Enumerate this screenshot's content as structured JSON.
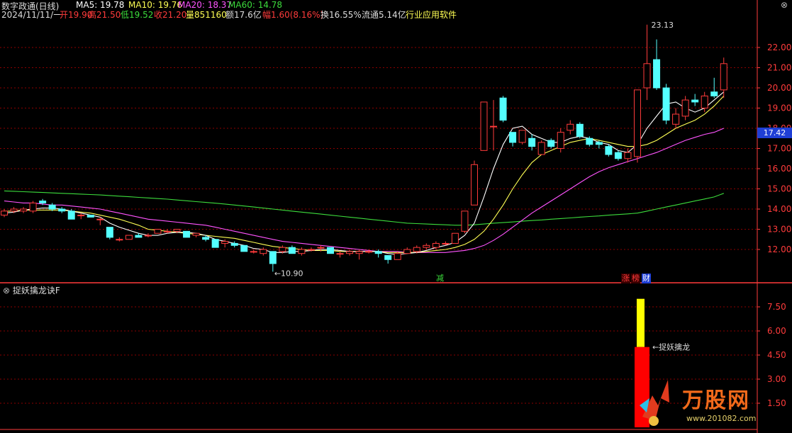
{
  "header": {
    "title": "数字政通(日线)",
    "ma5": "MA5: 19.78",
    "ma10": "MA10: 19.76",
    "ma20": "MA20: 18.37",
    "ma60": "MA60: 14.78",
    "date": "2024/11/11/一",
    "open": "开19.90",
    "high": "高21.50",
    "low": "低19.52",
    "close": "收21.20",
    "volume": "量851160",
    "amount": "额17.6亿",
    "change": "幅1.60(8.16%)",
    "turnover": "换16.55%",
    "float": "流通5.14亿",
    "industry": "行业应用软件"
  },
  "colors": {
    "up": "#ff3b3b",
    "down": "#54ffff",
    "ma5": "#ffffff",
    "ma10": "#ffff54",
    "ma20": "#ff54ff",
    "ma60": "#3cdc3c",
    "grid": "#8b0000",
    "axis": "#ff3b3b",
    "price_tag": "#1f3fd6",
    "signal_yellow": "#ffff00",
    "signal_red": "#ff0000"
  },
  "price_axis": {
    "ticks": [
      "22.00",
      "21.00",
      "20.00",
      "19.00",
      "18.00",
      "17.00",
      "16.00",
      "15.00",
      "14.00",
      "13.00",
      "12.00"
    ],
    "current_price": "17.42"
  },
  "annotations": {
    "high_label": "23.13",
    "low_label": "←10.90"
  },
  "tags": {
    "jian": "减",
    "zhang": "涨",
    "bang": "榜",
    "cai": "财"
  },
  "indicator": {
    "title": "捉妖擒龙诀F",
    "signal_label": "←捉妖擒龙",
    "ticks": [
      "7.50",
      "6.00",
      "4.50",
      "3.00",
      "1.50"
    ],
    "bar_yellow_top": 8.0,
    "bar_red_top": 5.0
  },
  "watermark": {
    "text": "万股网",
    "url": "www.201082.com"
  },
  "chart_data": {
    "type": "candlestick",
    "candles": [
      {
        "o": 13.7,
        "c": 13.9,
        "h": 14.0,
        "l": 13.6
      },
      {
        "o": 13.9,
        "c": 14.0,
        "h": 14.1,
        "l": 13.8
      },
      {
        "o": 13.9,
        "c": 14.0,
        "h": 14.1,
        "l": 13.8
      },
      {
        "o": 13.9,
        "c": 14.3,
        "h": 14.4,
        "l": 13.8
      },
      {
        "o": 14.4,
        "c": 14.3,
        "h": 14.5,
        "l": 14.2
      },
      {
        "o": 14.2,
        "c": 14.0,
        "h": 14.3,
        "l": 13.9
      },
      {
        "o": 14.0,
        "c": 13.9,
        "h": 14.1,
        "l": 13.8
      },
      {
        "o": 13.9,
        "c": 13.5,
        "h": 14.0,
        "l": 13.5
      },
      {
        "o": 13.7,
        "c": 13.7,
        "h": 13.8,
        "l": 13.5
      },
      {
        "o": 13.7,
        "c": 13.6,
        "h": 13.7,
        "l": 13.6
      },
      {
        "o": 13.5,
        "c": 13.5,
        "h": 13.6,
        "l": 13.2
      },
      {
        "o": 13.1,
        "c": 12.6,
        "h": 13.1,
        "l": 12.5
      },
      {
        "o": 12.5,
        "c": 12.5,
        "h": 12.6,
        "l": 12.4
      },
      {
        "o": 12.5,
        "c": 12.7,
        "h": 12.7,
        "l": 12.5
      },
      {
        "o": 12.7,
        "c": 12.6,
        "h": 12.8,
        "l": 12.6
      },
      {
        "o": 12.7,
        "c": 12.7,
        "h": 12.8,
        "l": 12.6
      },
      {
        "o": 12.8,
        "c": 13.0,
        "h": 13.0,
        "l": 12.8
      },
      {
        "o": 12.9,
        "c": 12.9,
        "h": 13.0,
        "l": 12.8
      },
      {
        "o": 12.9,
        "c": 13.0,
        "h": 13.0,
        "l": 12.8
      },
      {
        "o": 12.9,
        "c": 12.6,
        "h": 12.9,
        "l": 12.6
      },
      {
        "o": 12.7,
        "c": 12.8,
        "h": 12.8,
        "l": 12.6
      },
      {
        "o": 12.6,
        "c": 12.5,
        "h": 12.7,
        "l": 12.4
      },
      {
        "o": 12.5,
        "c": 12.1,
        "h": 12.5,
        "l": 12.1
      },
      {
        "o": 12.3,
        "c": 12.4,
        "h": 12.5,
        "l": 12.1
      },
      {
        "o": 12.3,
        "c": 12.2,
        "h": 12.4,
        "l": 12.1
      },
      {
        "o": 12.2,
        "c": 11.9,
        "h": 12.2,
        "l": 11.9
      },
      {
        "o": 11.9,
        "c": 11.9,
        "h": 12.0,
        "l": 11.8
      },
      {
        "o": 11.8,
        "c": 12.0,
        "h": 12.1,
        "l": 11.7
      },
      {
        "o": 11.9,
        "c": 11.3,
        "h": 11.9,
        "l": 10.9
      },
      {
        "o": 11.9,
        "c": 12.1,
        "h": 12.2,
        "l": 11.8
      },
      {
        "o": 12.1,
        "c": 11.8,
        "h": 12.2,
        "l": 11.8
      },
      {
        "o": 11.8,
        "c": 12.0,
        "h": 12.1,
        "l": 11.7
      },
      {
        "o": 12.0,
        "c": 12.0,
        "h": 12.1,
        "l": 11.9
      },
      {
        "o": 12.1,
        "c": 12.1,
        "h": 12.2,
        "l": 11.9
      },
      {
        "o": 12.1,
        "c": 11.8,
        "h": 12.1,
        "l": 11.8
      },
      {
        "o": 11.8,
        "c": 11.8,
        "h": 11.9,
        "l": 11.6
      },
      {
        "o": 11.8,
        "c": 11.9,
        "h": 12.0,
        "l": 11.7
      },
      {
        "o": 11.8,
        "c": 11.9,
        "h": 12.0,
        "l": 11.5
      },
      {
        "o": 11.9,
        "c": 11.9,
        "h": 12.0,
        "l": 11.8
      },
      {
        "o": 11.9,
        "c": 11.8,
        "h": 12.0,
        "l": 11.6
      },
      {
        "o": 11.7,
        "c": 11.5,
        "h": 11.7,
        "l": 11.3
      },
      {
        "o": 11.5,
        "c": 11.8,
        "h": 11.9,
        "l": 11.5
      },
      {
        "o": 11.8,
        "c": 12.0,
        "h": 12.1,
        "l": 11.8
      },
      {
        "o": 11.9,
        "c": 12.1,
        "h": 12.2,
        "l": 11.8
      },
      {
        "o": 12.1,
        "c": 12.2,
        "h": 12.3,
        "l": 12.0
      },
      {
        "o": 12.1,
        "c": 12.3,
        "h": 12.4,
        "l": 12.0
      },
      {
        "o": 12.3,
        "c": 12.3,
        "h": 12.4,
        "l": 12.2
      },
      {
        "o": 12.3,
        "c": 12.8,
        "h": 12.8,
        "l": 12.3
      },
      {
        "o": 12.9,
        "c": 13.9,
        "h": 13.9,
        "l": 12.8
      },
      {
        "o": 14.2,
        "c": 16.2,
        "h": 16.4,
        "l": 14.2
      },
      {
        "o": 16.9,
        "c": 19.3,
        "h": 19.3,
        "l": 16.9
      },
      {
        "o": 18.1,
        "c": 18.1,
        "h": 19.4,
        "l": 16.9
      },
      {
        "o": 19.5,
        "c": 18.4,
        "h": 19.6,
        "l": 18.3
      },
      {
        "o": 17.8,
        "c": 17.3,
        "h": 17.8,
        "l": 17.1
      },
      {
        "o": 17.3,
        "c": 17.9,
        "h": 17.9,
        "l": 17.2
      },
      {
        "o": 17.5,
        "c": 17.1,
        "h": 17.7,
        "l": 16.9
      },
      {
        "o": 16.7,
        "c": 17.3,
        "h": 17.4,
        "l": 16.7
      },
      {
        "o": 17.4,
        "c": 17.1,
        "h": 17.5,
        "l": 17.0
      },
      {
        "o": 17.0,
        "c": 17.8,
        "h": 18.0,
        "l": 16.8
      },
      {
        "o": 17.9,
        "c": 18.2,
        "h": 18.4,
        "l": 17.7
      },
      {
        "o": 18.2,
        "c": 17.6,
        "h": 18.3,
        "l": 17.5
      },
      {
        "o": 17.5,
        "c": 17.2,
        "h": 17.6,
        "l": 17.1
      },
      {
        "o": 17.3,
        "c": 17.2,
        "h": 17.4,
        "l": 17.0
      },
      {
        "o": 17.1,
        "c": 16.7,
        "h": 17.2,
        "l": 16.6
      },
      {
        "o": 16.8,
        "c": 16.5,
        "h": 16.9,
        "l": 16.4
      },
      {
        "o": 16.5,
        "c": 16.8,
        "h": 17.0,
        "l": 16.3
      },
      {
        "o": 16.6,
        "c": 19.9,
        "h": 19.9,
        "l": 16.3
      },
      {
        "o": 20.0,
        "c": 21.2,
        "h": 23.13,
        "l": 19.4
      },
      {
        "o": 21.4,
        "c": 20.0,
        "h": 22.4,
        "l": 19.9
      },
      {
        "o": 20.0,
        "c": 18.4,
        "h": 20.2,
        "l": 18.2
      },
      {
        "o": 18.2,
        "c": 18.7,
        "h": 19.0,
        "l": 18.0
      },
      {
        "o": 18.6,
        "c": 19.4,
        "h": 19.6,
        "l": 18.4
      },
      {
        "o": 19.4,
        "c": 19.3,
        "h": 19.7,
        "l": 19.1
      },
      {
        "o": 19.0,
        "c": 19.6,
        "h": 19.8,
        "l": 18.8
      },
      {
        "o": 19.8,
        "c": 19.6,
        "h": 20.5,
        "l": 19.5
      },
      {
        "o": 19.9,
        "c": 21.2,
        "h": 21.5,
        "l": 19.5
      }
    ],
    "ma5": [
      13.8,
      13.85,
      13.95,
      14.0,
      14.05,
      14.05,
      14.0,
      13.9,
      13.8,
      13.7,
      13.6,
      13.3,
      13.1,
      12.95,
      12.8,
      12.7,
      12.7,
      12.8,
      12.85,
      12.85,
      12.8,
      12.7,
      12.5,
      12.4,
      12.3,
      12.2,
      12.05,
      12.0,
      11.85,
      11.85,
      11.9,
      11.9,
      11.95,
      12.0,
      12.0,
      11.95,
      11.9,
      11.9,
      11.9,
      11.9,
      11.8,
      11.75,
      11.8,
      11.85,
      11.95,
      12.1,
      12.2,
      12.35,
      12.7,
      13.3,
      14.6,
      16.0,
      17.2,
      18.0,
      18.1,
      17.7,
      17.5,
      17.3,
      17.3,
      17.5,
      17.6,
      17.5,
      17.3,
      17.2,
      16.9,
      16.8,
      17.2,
      18.0,
      18.6,
      19.2,
      19.3,
      19.0,
      18.8,
      19.0,
      19.4,
      19.8
    ],
    "ma10": [
      13.9,
      13.9,
      13.95,
      13.95,
      13.95,
      13.95,
      13.95,
      13.9,
      13.85,
      13.8,
      13.7,
      13.6,
      13.5,
      13.35,
      13.2,
      13.0,
      12.95,
      12.9,
      12.85,
      12.8,
      12.75,
      12.7,
      12.65,
      12.6,
      12.55,
      12.45,
      12.35,
      12.25,
      12.15,
      12.1,
      12.05,
      12.0,
      11.95,
      11.95,
      11.95,
      11.9,
      11.9,
      11.9,
      11.9,
      11.9,
      11.85,
      11.85,
      11.85,
      11.85,
      11.9,
      11.95,
      12.0,
      12.1,
      12.25,
      12.5,
      12.9,
      13.5,
      14.2,
      15.0,
      15.7,
      16.3,
      16.7,
      16.9,
      17.1,
      17.3,
      17.4,
      17.5,
      17.4,
      17.3,
      17.2,
      17.1,
      17.1,
      17.2,
      17.4,
      17.7,
      18.0,
      18.2,
      18.4,
      18.7,
      19.1,
      19.6
    ],
    "ma20": [
      14.4,
      14.35,
      14.3,
      14.3,
      14.25,
      14.2,
      14.2,
      14.15,
      14.1,
      14.05,
      14.0,
      13.9,
      13.8,
      13.7,
      13.6,
      13.5,
      13.45,
      13.4,
      13.35,
      13.3,
      13.25,
      13.2,
      13.1,
      13.0,
      12.9,
      12.8,
      12.7,
      12.6,
      12.5,
      12.4,
      12.35,
      12.3,
      12.25,
      12.2,
      12.15,
      12.1,
      12.05,
      12.0,
      11.95,
      11.9,
      11.9,
      11.9,
      11.85,
      11.85,
      11.85,
      11.85,
      11.85,
      11.9,
      11.95,
      12.05,
      12.2,
      12.45,
      12.75,
      13.1,
      13.45,
      13.8,
      14.1,
      14.4,
      14.7,
      15.0,
      15.3,
      15.6,
      15.85,
      16.05,
      16.2,
      16.35,
      16.5,
      16.65,
      16.8,
      17.0,
      17.2,
      17.4,
      17.55,
      17.7,
      17.8,
      18.0
    ],
    "ma60": [
      14.9,
      14.88,
      14.86,
      14.84,
      14.82,
      14.8,
      14.78,
      14.76,
      14.74,
      14.72,
      14.7,
      14.67,
      14.64,
      14.61,
      14.58,
      14.55,
      14.52,
      14.49,
      14.45,
      14.41,
      14.37,
      14.33,
      14.29,
      14.25,
      14.2,
      14.15,
      14.1,
      14.05,
      14.0,
      13.95,
      13.9,
      13.85,
      13.8,
      13.75,
      13.7,
      13.65,
      13.6,
      13.55,
      13.5,
      13.45,
      13.4,
      13.35,
      13.3,
      13.28,
      13.26,
      13.24,
      13.22,
      13.2,
      13.2,
      13.22,
      13.26,
      13.3,
      13.33,
      13.36,
      13.4,
      13.43,
      13.46,
      13.5,
      13.53,
      13.56,
      13.6,
      13.63,
      13.66,
      13.7,
      13.73,
      13.76,
      13.8,
      13.9,
      14.0,
      14.1,
      14.2,
      14.3,
      14.4,
      14.5,
      14.6,
      14.78
    ],
    "ylim": [
      11.0,
      23.5
    ]
  }
}
